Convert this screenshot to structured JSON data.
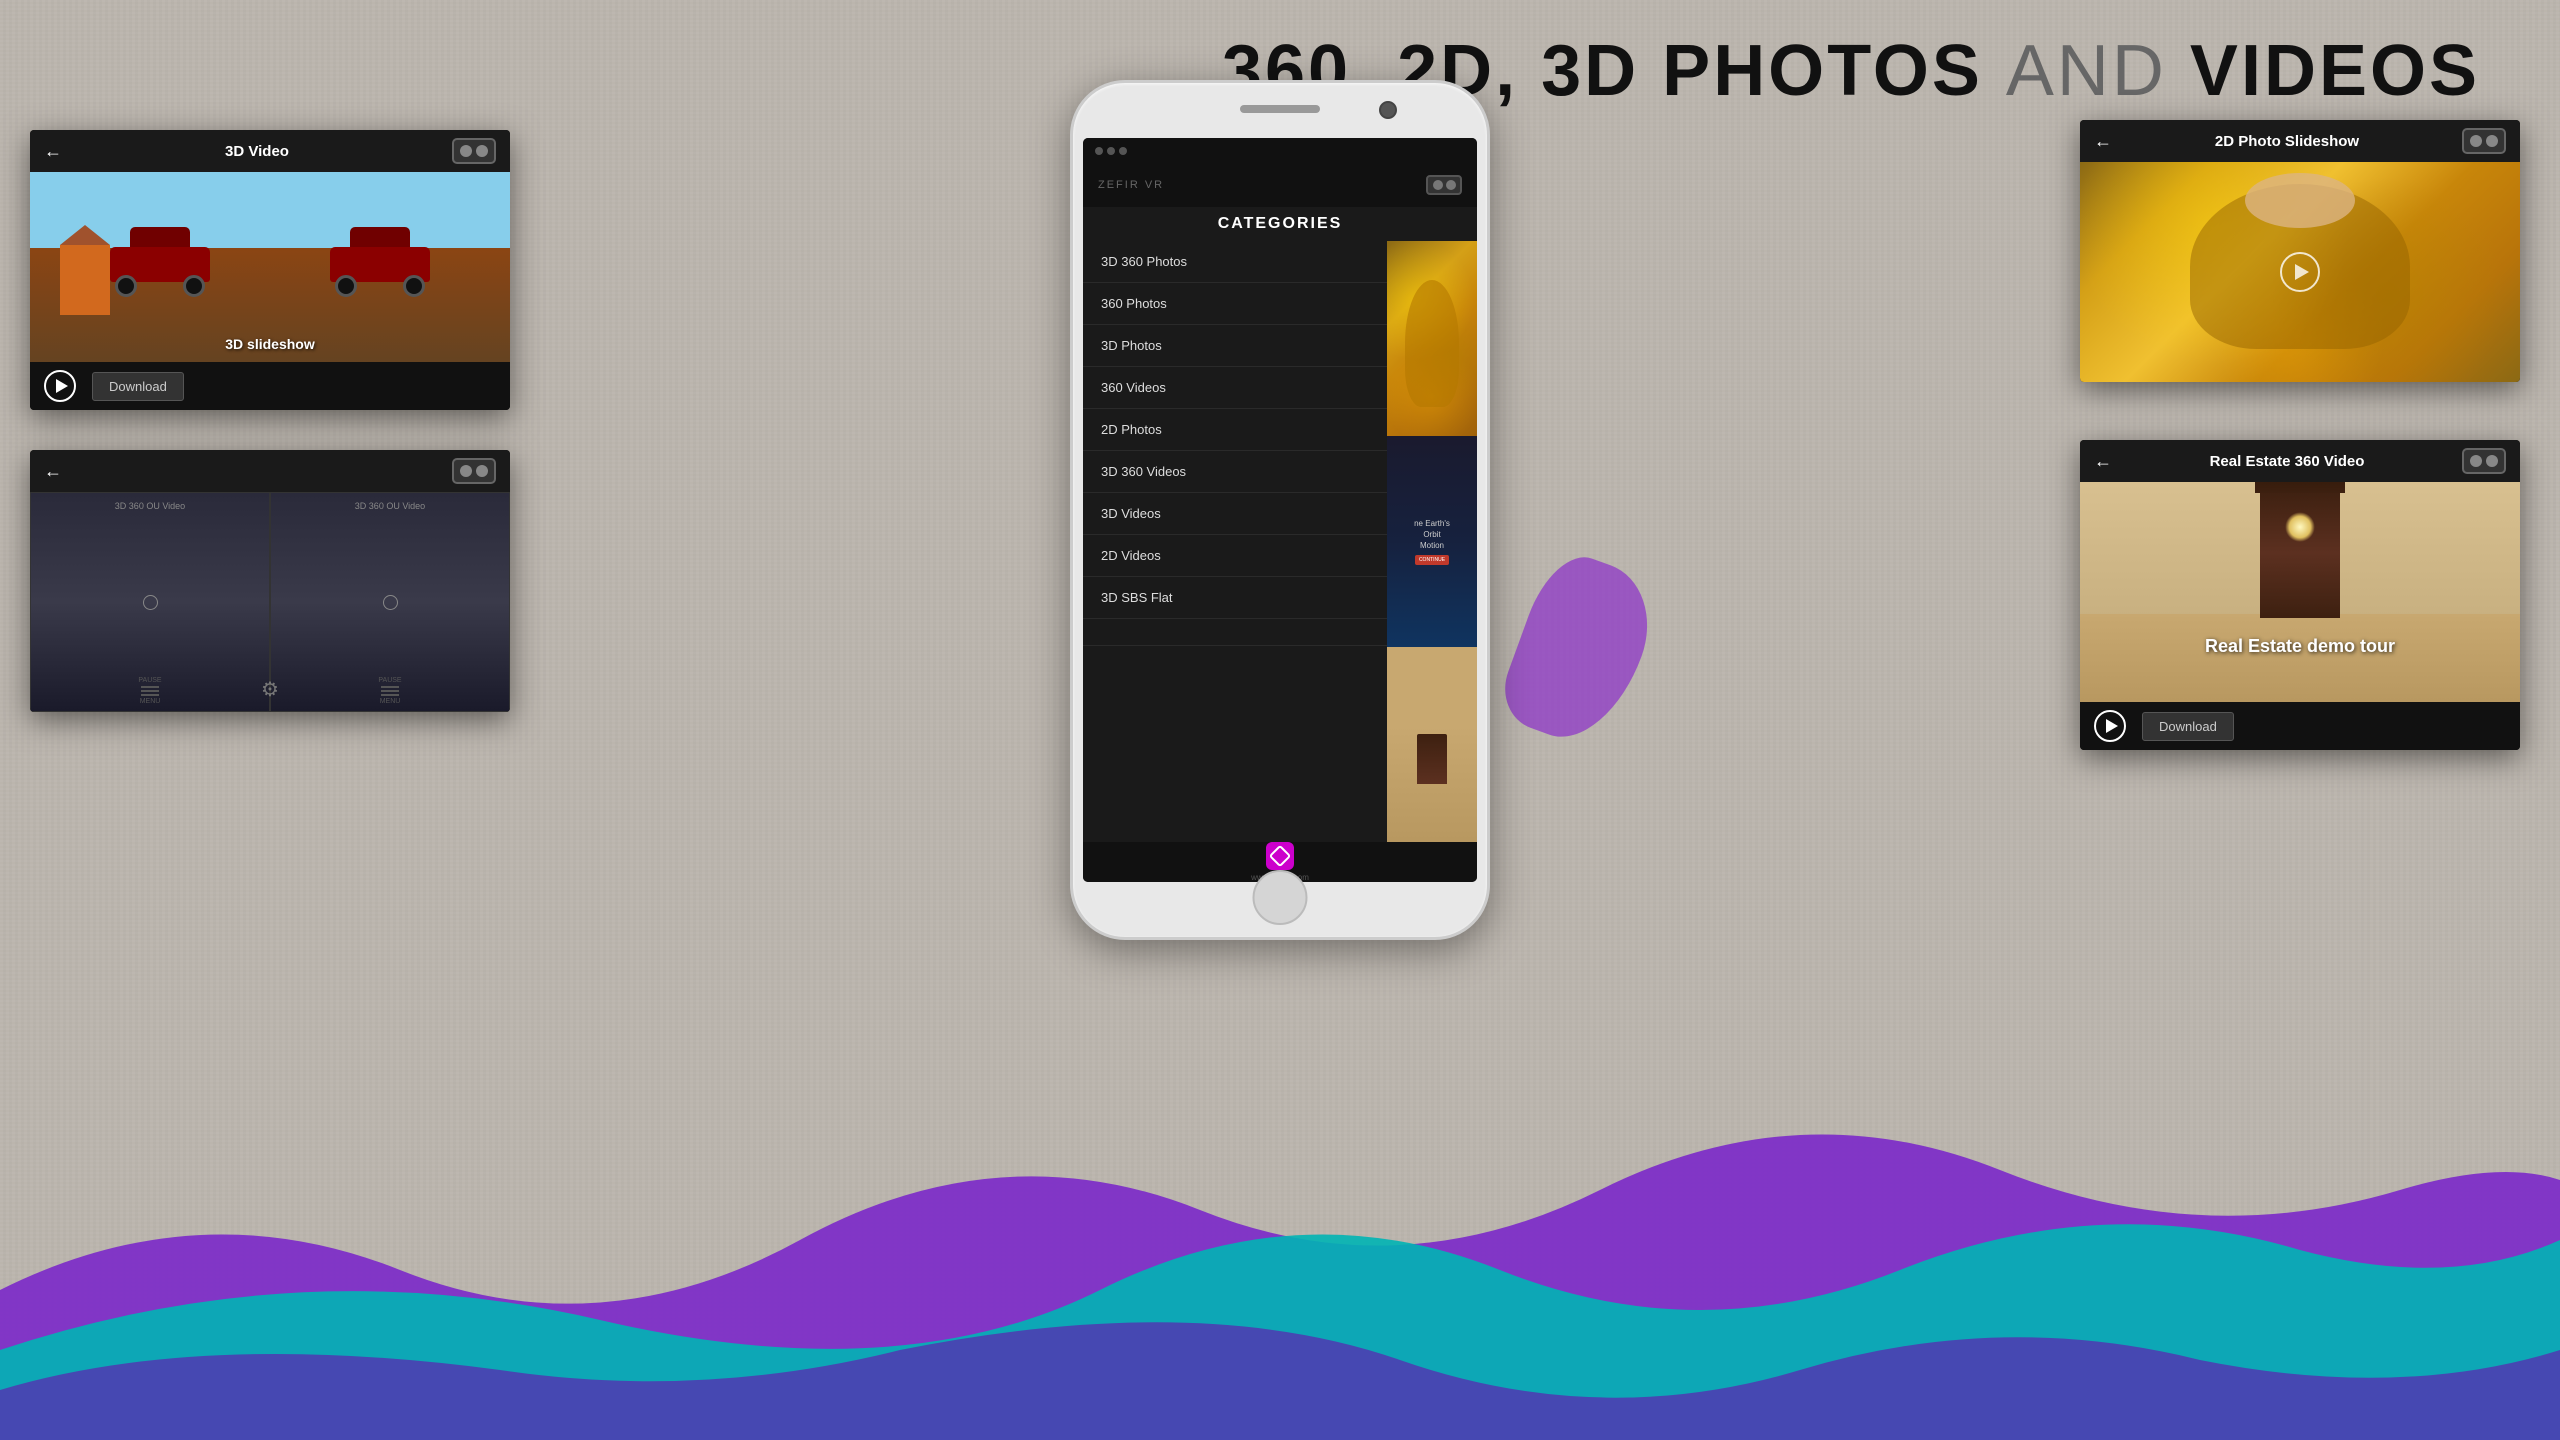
{
  "page": {
    "title": "360, 2D, 3D PHOTOS AND VIDEOS",
    "title_light_words": "AND",
    "background_color": "#bbb5ad"
  },
  "top_card_left": {
    "title": "3D Video",
    "back_arrow": "←",
    "label": "3D slideshow",
    "download_btn": "Download",
    "play_btn": "▶"
  },
  "top_card_right": {
    "title": "2D Photo Slideshow",
    "back_arrow": "←"
  },
  "bottom_card_left": {
    "title": "3D 360 OU Video",
    "gear": "⚙"
  },
  "bottom_card_right": {
    "title": "Real Estate 360 Video",
    "back_arrow": "←",
    "label": "Real Estate demo tour",
    "download_btn": "Download"
  },
  "phone": {
    "logo_text": "ZEFIR VR",
    "categories_title": "CATEGORIES",
    "website": "www.zefirvr.com",
    "categories": [
      {
        "id": 1,
        "name": "3D 360 Photos"
      },
      {
        "id": 2,
        "name": "360 Photos"
      },
      {
        "id": 3,
        "name": "3D Photos"
      },
      {
        "id": 4,
        "name": "360 Videos"
      },
      {
        "id": 5,
        "name": "2D Photos"
      },
      {
        "id": 6,
        "name": "3D 360 Videos"
      },
      {
        "id": 7,
        "name": "3D Videos"
      },
      {
        "id": 8,
        "name": "2D Videos"
      },
      {
        "id": 9,
        "name": "3D SBS Flat"
      }
    ],
    "thumb_space_text": "ne Earth's\nOrbit\nMotion",
    "continue_text": "CONTINUE"
  },
  "colors": {
    "dark_bg": "#1a1a1a",
    "header_bg": "#111111",
    "category_text": "#dddddd",
    "accent_purple": "#8b2fc9",
    "accent_cyan": "#00d4d4",
    "download_bg": "#333333"
  }
}
